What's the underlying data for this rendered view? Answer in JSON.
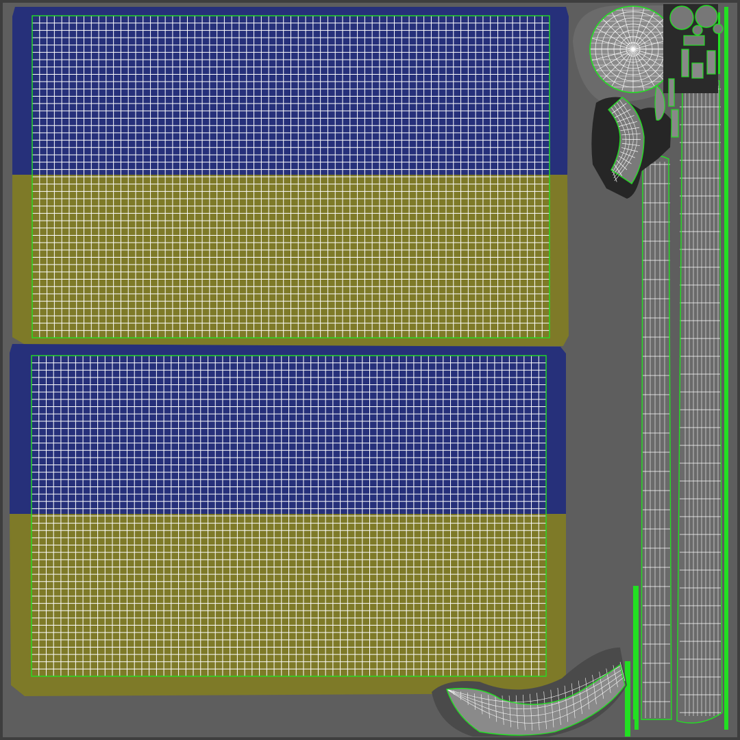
{
  "uv_layout": {
    "background_color": "#5e5e5e",
    "border_color": "#3e3e3e",
    "texture_colors": {
      "blue": "#26307a",
      "yellow": "#7e7a28",
      "cloth_grey": "#6a6a6a",
      "dark_fold": "#2e2e2e"
    },
    "wire_colors": {
      "grid": "#ffffff",
      "seam": "#22e022"
    },
    "islands": [
      {
        "name": "flag-panel-top",
        "stripes": [
          "blue",
          "yellow"
        ]
      },
      {
        "name": "flag-panel-bottom",
        "stripes": [
          "blue",
          "yellow"
        ]
      },
      {
        "name": "pole-strip-tall"
      },
      {
        "name": "pole-strip-medium"
      },
      {
        "name": "pole-strip-thin"
      },
      {
        "name": "cap-disc-large"
      },
      {
        "name": "arc-piece-top"
      },
      {
        "name": "arc-piece-bottom"
      },
      {
        "name": "small-parts-cluster"
      }
    ]
  }
}
